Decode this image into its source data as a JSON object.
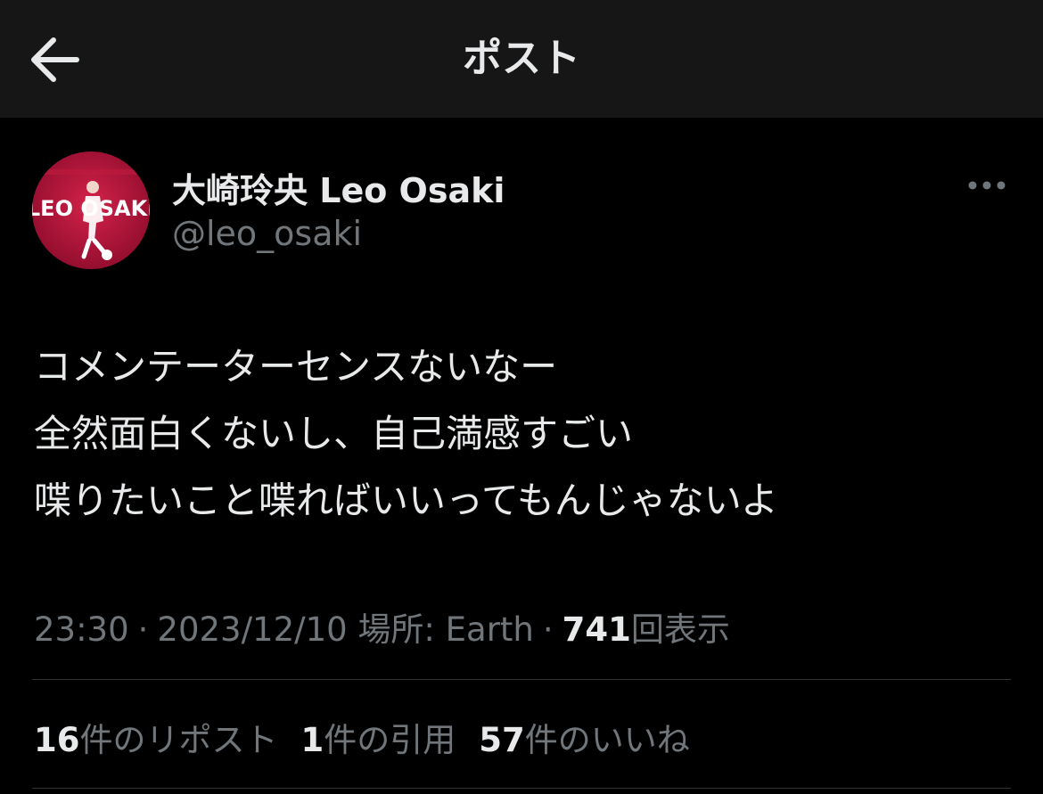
{
  "header": {
    "title": "ポスト",
    "back_icon": "arrow-left-icon"
  },
  "author": {
    "display_name": "大崎玲央 Leo Osaki",
    "handle": "@leo_osaki",
    "avatar_text": "LEO OSAKI"
  },
  "more_icon": "more-horizontal-icon",
  "post": {
    "lines": [
      "コメンテーターセンスないなー",
      "全然面白くないし、自己満感すごい",
      "喋りたいこと喋ればいいってもんじゃないよ"
    ]
  },
  "meta": {
    "time": "23:30",
    "separator": "·",
    "date": "2023/12/10",
    "location": "場所: Earth",
    "views_count": "741",
    "views_label": "回表示"
  },
  "stats": {
    "reposts_count": "16",
    "reposts_label": "件のリポスト",
    "quotes_count": "1",
    "quotes_label": "件の引用",
    "likes_count": "57",
    "likes_label": "件のいいね"
  },
  "colors": {
    "background": "#000000",
    "header_background": "#161616",
    "primary_text": "#e7e9ea",
    "secondary_text": "#71767b",
    "divider": "#2f3336",
    "avatar_red": "#b0123a"
  }
}
